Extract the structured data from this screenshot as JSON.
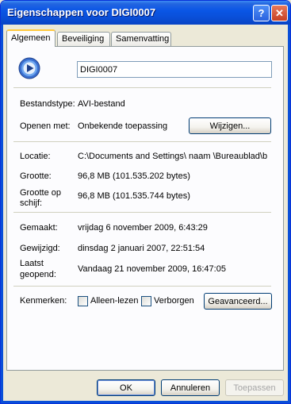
{
  "window": {
    "title": "Eigenschappen voor DIGI0007",
    "help_glyph": "?",
    "close_glyph": "✕"
  },
  "tabs": [
    {
      "label": "Algemeen",
      "active": true
    },
    {
      "label": "Beveiliging",
      "active": false
    },
    {
      "label": "Samenvatting",
      "active": false
    }
  ],
  "general": {
    "file_name": "DIGI0007",
    "file_type_label": "Bestandstype:",
    "file_type_value": "AVI-bestand",
    "opens_with_label": "Openen met:",
    "opens_with_value": "Onbekende toepassing",
    "change_button": "Wijzigen...",
    "location_label": "Locatie:",
    "location_value": "C:\\Documents and Settings\\  naam \\Bureaublad\\b",
    "size_label": "Grootte:",
    "size_value": "96,8 MB (101.535.202 bytes)",
    "size_on_disk_label_1": "Grootte op",
    "size_on_disk_label_2": "schijf:",
    "size_on_disk_value": "96,8 MB (101.535.744 bytes)",
    "created_label": "Gemaakt:",
    "created_value": "vrijdag 6 november 2009, 6:43:29",
    "modified_label": "Gewijzigd:",
    "modified_value": "dinsdag 2 januari 2007, 22:51:54",
    "accessed_label_1": "Laatst",
    "accessed_label_2": "geopend:",
    "accessed_value": "Vandaag 21 november 2009, 16:47:05",
    "attributes_label": "Kenmerken:",
    "readonly_label": "Alleen-lezen",
    "readonly_checked": false,
    "hidden_label": "Verborgen",
    "hidden_checked": false,
    "advanced_button": "Geavanceerd..."
  },
  "buttons": {
    "ok": "OK",
    "cancel": "Annuleren",
    "apply": "Toepassen"
  },
  "colors": {
    "titlebar": "#0a4fd8",
    "dialog_bg": "#ece9d8",
    "tab_highlight": "#ffc83c"
  }
}
